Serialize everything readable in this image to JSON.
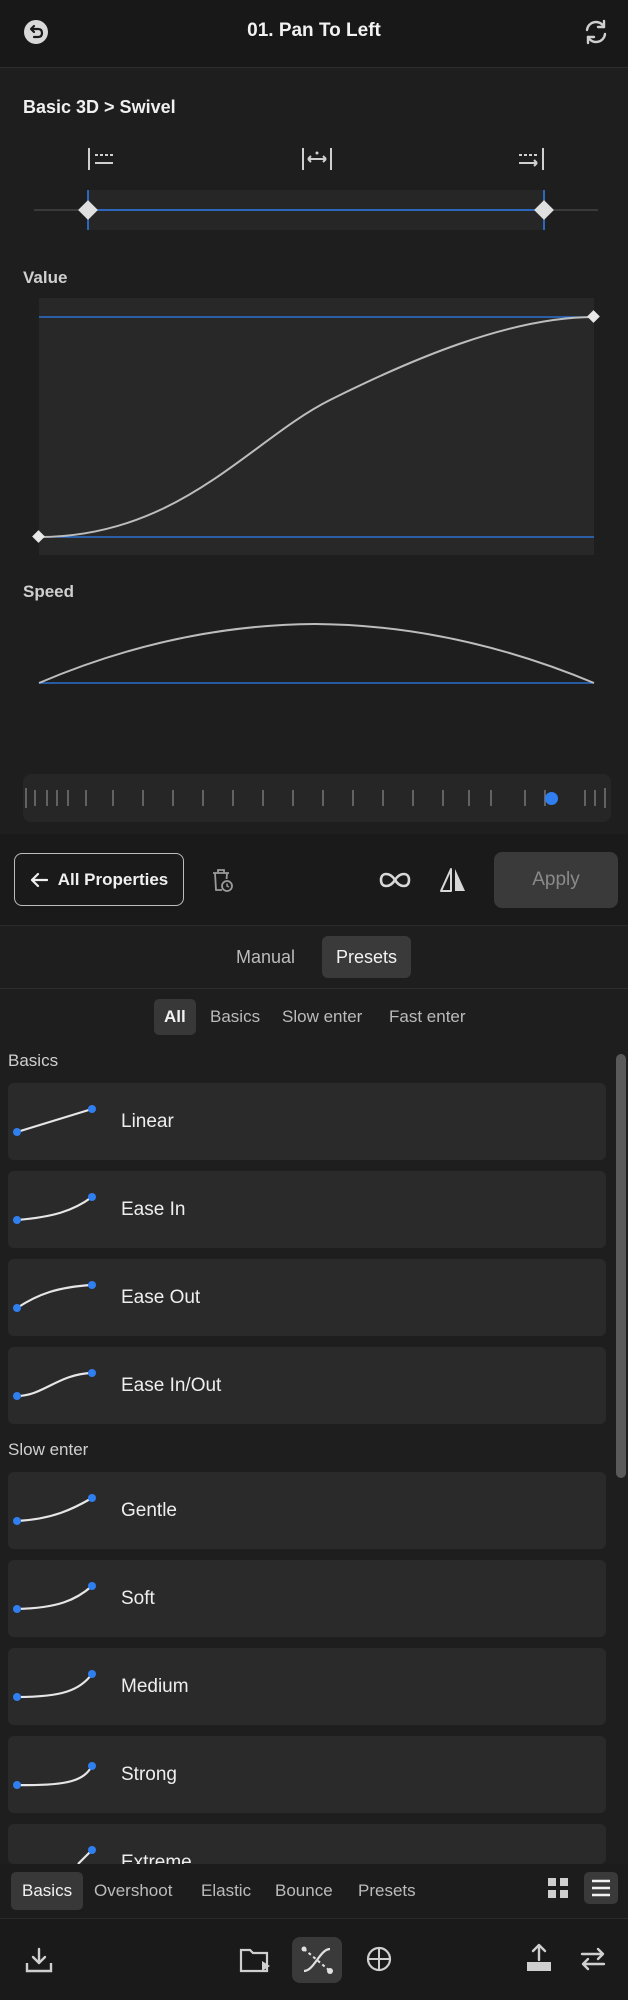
{
  "header": {
    "title": "01. Pan To Left",
    "undo_icon": "undo-icon",
    "refresh_icon": "refresh-icon"
  },
  "editor": {
    "property_path": "Basic 3D > Swivel",
    "value_label": "Value",
    "speed_label": "Speed"
  },
  "actions": {
    "all_properties_label": "All Properties",
    "apply_label": "Apply"
  },
  "mode_tabs": {
    "manual": "Manual",
    "presets": "Presets",
    "selected": "Presets"
  },
  "filters": {
    "all": "All",
    "basics": "Basics",
    "slow_enter": "Slow enter",
    "fast_enter": "Fast enter",
    "selected": "All"
  },
  "sections": {
    "basics": "Basics",
    "slow_enter": "Slow enter"
  },
  "presets_basics": [
    "Linear",
    "Ease In",
    "Ease Out",
    "Ease In/Out"
  ],
  "presets_slow": [
    "Gentle",
    "Soft",
    "Medium",
    "Strong",
    "Extreme"
  ],
  "bottom_tabs": {
    "basics": "Basics",
    "overshoot": "Overshoot",
    "elastic": "Elastic",
    "bounce": "Bounce",
    "presets": "Presets",
    "selected": "Basics"
  },
  "colors": {
    "accent": "#2f7ff0",
    "background": "#1e1e1e",
    "panel": "#2a2a2a"
  }
}
